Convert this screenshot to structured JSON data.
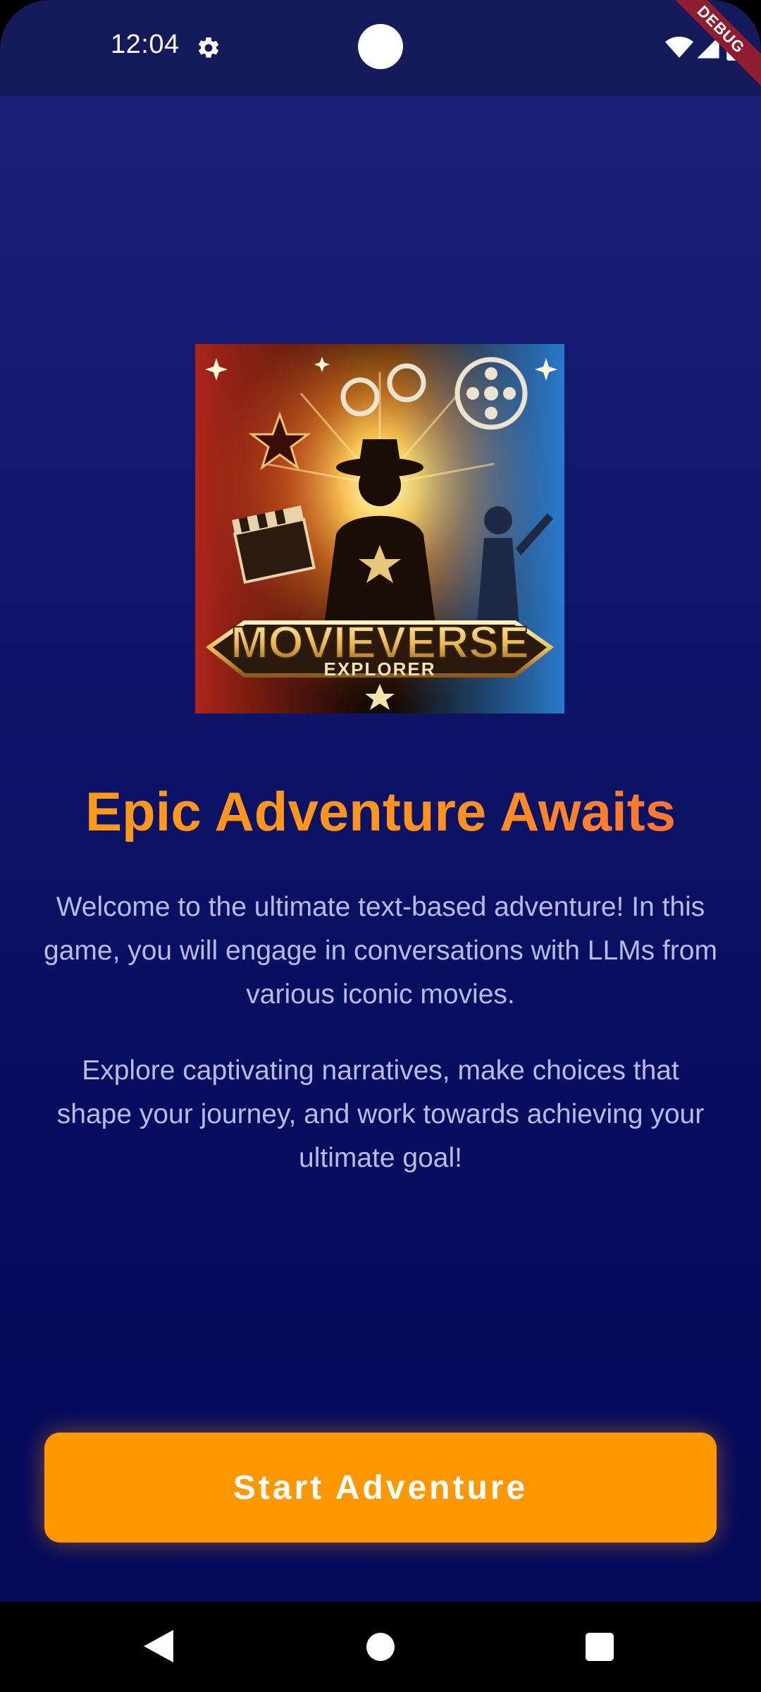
{
  "status_bar": {
    "time": "12:04",
    "icons": [
      "gear-icon",
      "wifi-icon",
      "signal-icon",
      "battery-icon"
    ],
    "debug_banner": "DEBUG"
  },
  "hero": {
    "logo_title": "MOVIEVERSE",
    "logo_subtitle": "EXPLORER"
  },
  "main": {
    "title": "Epic Adventure Awaits",
    "paragraph_1": "Welcome to the ultimate text-based adventure! In this game, you will engage in conversations with LLMs from various iconic movies.",
    "paragraph_2": "Explore captivating narratives, make choices that shape your journey, and work towards achieving your ultimate goal!",
    "start_button_label": "Start Adventure"
  },
  "colors": {
    "accent": "#ff9800",
    "title": "#ff9a1e",
    "background_top": "#1b217a",
    "background_bottom": "#05095a",
    "body_text": "#b9bce2"
  },
  "nav_bar": {
    "icons": [
      "back-icon",
      "home-icon",
      "recents-icon"
    ]
  }
}
